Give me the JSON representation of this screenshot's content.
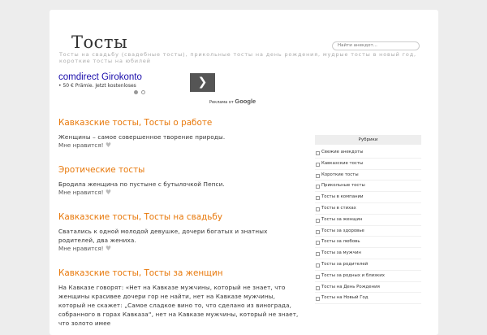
{
  "header": {
    "title": "Тосты",
    "tagline": "Тосты на свадьбу (свадебные тосты), прикольные тосты на день рождения, мудрые тосты в новый год, короткие тосты на юбилей",
    "search_placeholder": "Найти анекдот..."
  },
  "ad": {
    "title": "comdirect Girokonto",
    "text": "• 50 € Prämie. Jetzt kostenloses",
    "arrow": "❯",
    "by_label": "Реклама от",
    "by_brand": "Google"
  },
  "posts": [
    {
      "title": "Кавказские тосты, Тосты о работе",
      "body": " Женщины – самое совершенное творение природы.",
      "likes": "Мне нравится!"
    },
    {
      "title": "Эротические тосты",
      "body": "Бродила женщина по пустыне с бутылочкой Пепси.",
      "likes": "Мне нравится!"
    },
    {
      "title": "Кавказские тосты, Тосты на свадьбу",
      "body": " Сватались к одной молодой девушке, дочери богатых и знатных родителей, два жениха.",
      "likes": "Мне нравится!"
    },
    {
      "title": "Кавказские тосты, Тосты за женщин",
      "body": " На Кавказе говорят: «Нет на Кавказе мужчины, который не знает, что женщины красивее дочери гор не найти, нет на Кавказе мужчины, который не скажет: „Самое сладкое вино то, что сделано из винограда, собранного в горах Кавказа“, нет на Кавказе мужчины, который не знает, что золото имее",
      "likes": ""
    }
  ],
  "sidebar": {
    "heading": "Рубрики",
    "items": [
      "Свежие анекдоты",
      "Кавказские тосты",
      "Короткие тосты",
      "Прикольные тосты",
      "Тосты в компании",
      "Тосты в стихах",
      "Тосты за женщин",
      "Тосты за здоровье",
      "Тосты за любовь",
      "Тосты за мужчин",
      "Тосты за родителей",
      "Тосты за родных и близких",
      "Тосты на День Рождения",
      "Тосты на Новый Год"
    ]
  }
}
